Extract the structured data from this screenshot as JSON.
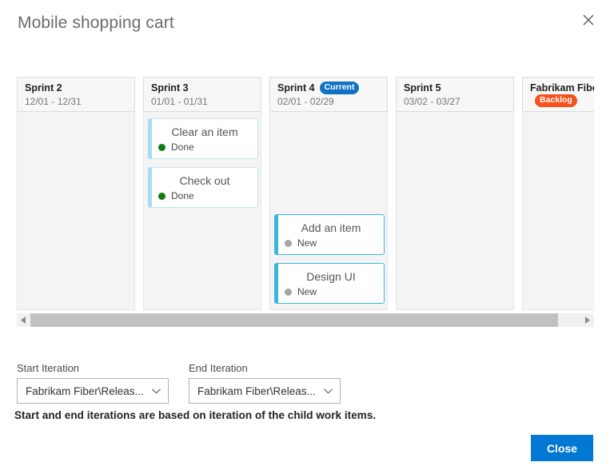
{
  "dialog": {
    "title": "Mobile shopping cart",
    "close_icon": "close-icon"
  },
  "board": {
    "columns": [
      {
        "name": "Sprint 2",
        "dates": "12/01 - 12/31",
        "badge": null,
        "badge_kind": null,
        "cards": []
      },
      {
        "name": "Sprint 3",
        "dates": "01/01 - 01/31",
        "badge": null,
        "badge_kind": null,
        "cards": [
          {
            "title": "Clear an item",
            "state": "Done",
            "state_color": "#107c10",
            "selected": false,
            "offset": 0
          },
          {
            "title": "Check out",
            "state": "Done",
            "state_color": "#107c10",
            "selected": false,
            "offset": 0
          }
        ]
      },
      {
        "name": "Sprint 4",
        "dates": "02/01 - 02/29",
        "badge": "Current",
        "badge_kind": "current",
        "cards": [
          {
            "title": "Add an item",
            "state": "New",
            "state_color": "#a6a6a6",
            "selected": true,
            "offset": 120
          },
          {
            "title": "Design UI",
            "state": "New",
            "state_color": "#a6a6a6",
            "selected": true,
            "offset": 0
          }
        ]
      },
      {
        "name": "Sprint 5",
        "dates": "03/02 - 03/27",
        "badge": null,
        "badge_kind": null,
        "cards": []
      },
      {
        "name": "Fabrikam Fiber",
        "dates": "",
        "badge": "Backlog",
        "badge_kind": "backlog",
        "cards": []
      }
    ]
  },
  "scrollbar": {
    "left_arrow_icon": "chevron-left-icon",
    "right_arrow_icon": "chevron-right-icon",
    "thumb_position_percent": 0,
    "thumb_width_percent": 96
  },
  "pickers": {
    "start": {
      "label": "Start Iteration",
      "value": "Fabrikam Fiber\\Releas...",
      "chevron_icon": "chevron-down-icon"
    },
    "end": {
      "label": "End Iteration",
      "value": "Fabrikam Fiber\\Releas...",
      "chevron_icon": "chevron-down-icon"
    }
  },
  "footnote": "Start and end iterations are based on iteration of the child work items.",
  "footer": {
    "close_label": "Close",
    "accent_color": "#0078d4"
  }
}
